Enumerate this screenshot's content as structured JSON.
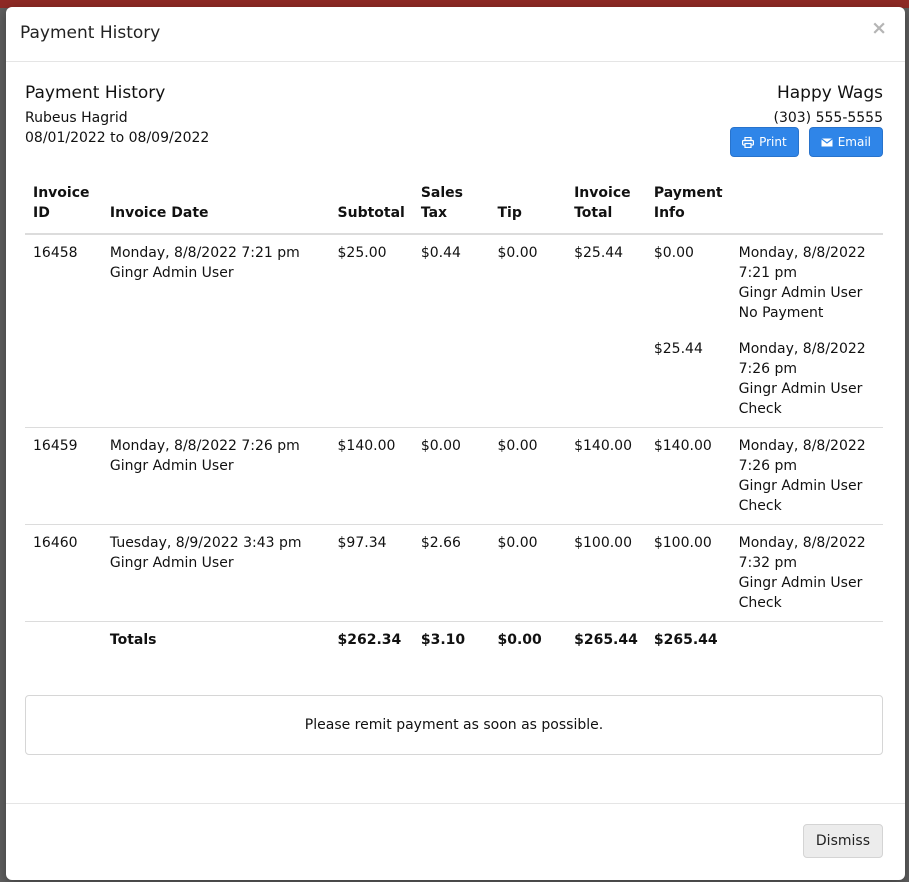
{
  "modal": {
    "title": "Payment History",
    "close_glyph": "×"
  },
  "report": {
    "title": "Payment History",
    "customer": "Rubeus Hagrid",
    "date_range": "08/01/2022 to 08/09/2022",
    "business_name": "Happy Wags",
    "business_phone": "(303) 555-5555"
  },
  "buttons": {
    "print_label": "Print",
    "email_label": "Email",
    "dismiss_label": "Dismiss"
  },
  "table": {
    "headers": {
      "invoice_id": [
        "Invoice",
        "ID"
      ],
      "invoice_date": "Invoice Date",
      "subtotal": "Subtotal",
      "sales_tax": [
        "Sales",
        "Tax"
      ],
      "tip": "Tip",
      "invoice_total": [
        "Invoice",
        "Total"
      ],
      "payment_info": [
        "Payment",
        "Info"
      ]
    },
    "invoices": [
      {
        "id": "16458",
        "date": "Monday, 8/8/2022 7:21 pm Gingr Admin User",
        "subtotal": "$25.00",
        "sales_tax": "$0.44",
        "tip": "$0.00",
        "total": "$25.44",
        "payments": [
          {
            "amount": "$0.00",
            "line1": "Monday, 8/8/2022",
            "line2": "7:21 pm",
            "line3": "Gingr Admin User",
            "line4": "No Payment"
          },
          {
            "amount": "$25.44",
            "line1": "Monday, 8/8/2022",
            "line2": "7:26 pm",
            "line3": "Gingr Admin User",
            "line4": "Check"
          }
        ]
      },
      {
        "id": "16459",
        "date": "Monday, 8/8/2022 7:26 pm Gingr Admin User",
        "subtotal": "$140.00",
        "sales_tax": "$0.00",
        "tip": "$0.00",
        "total": "$140.00",
        "payments": [
          {
            "amount": "$140.00",
            "line1": "Monday, 8/8/2022",
            "line2": "7:26 pm",
            "line3": "Gingr Admin User",
            "line4": "Check"
          }
        ]
      },
      {
        "id": "16460",
        "date": "Tuesday, 8/9/2022 3:43 pm Gingr Admin User",
        "subtotal": "$97.34",
        "sales_tax": "$2.66",
        "tip": "$0.00",
        "total": "$100.00",
        "payments": [
          {
            "amount": "$100.00",
            "line1": "Monday, 8/8/2022",
            "line2": "7:32 pm",
            "line3": "Gingr Admin User",
            "line4": "Check"
          }
        ]
      }
    ],
    "totals": {
      "label": "Totals",
      "subtotal": "$262.34",
      "sales_tax": "$3.10",
      "tip": "$0.00",
      "total": "$265.44",
      "payment": "$265.44"
    }
  },
  "notice": "Please remit payment as soon as possible.",
  "colors": {
    "primary_button": "#2f85e8",
    "overlay": "#5f5f5f"
  },
  "icons": {
    "print": "printer-icon",
    "email": "envelope-icon"
  }
}
